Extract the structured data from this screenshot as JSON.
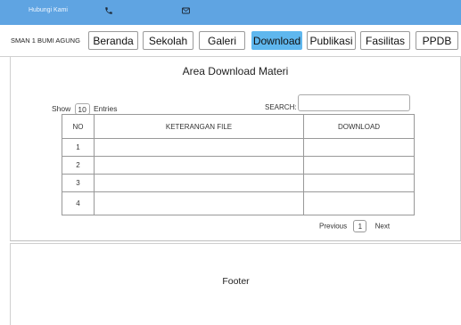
{
  "topbar": {
    "contact_label": "Hubungi Kami",
    "icons": [
      "phone-icon",
      "mail-icon"
    ],
    "color": "#5fa4e2"
  },
  "navbar": {
    "brand": "SMAN 1 BUMI AGUNG",
    "items": [
      {
        "label": "Beranda"
      },
      {
        "label": "Sekolah"
      },
      {
        "label": "Galeri"
      },
      {
        "label": "Download",
        "active": true
      },
      {
        "label": "Publikasi"
      },
      {
        "label": "Fasilitas"
      },
      {
        "label": "PPDB"
      }
    ],
    "active_color": "#5fb7ee"
  },
  "main": {
    "title": "Area Download Materi",
    "show_label": "Show",
    "show_value": "10",
    "entries_label": "Entries",
    "search_label": "SEARCH:",
    "search_value": "",
    "table": {
      "headers": [
        "NO",
        "KETERANGAN FILE",
        "DOWNLOAD"
      ],
      "rows": [
        {
          "no": "1",
          "desc": "",
          "download": ""
        },
        {
          "no": "2",
          "desc": "",
          "download": ""
        },
        {
          "no": "3",
          "desc": "",
          "download": ""
        },
        {
          "no": "4",
          "desc": "",
          "download": ""
        }
      ]
    },
    "pagination": {
      "previous": "Previous",
      "current": "1",
      "next": "Next"
    }
  },
  "footer": {
    "text": "Footer"
  }
}
